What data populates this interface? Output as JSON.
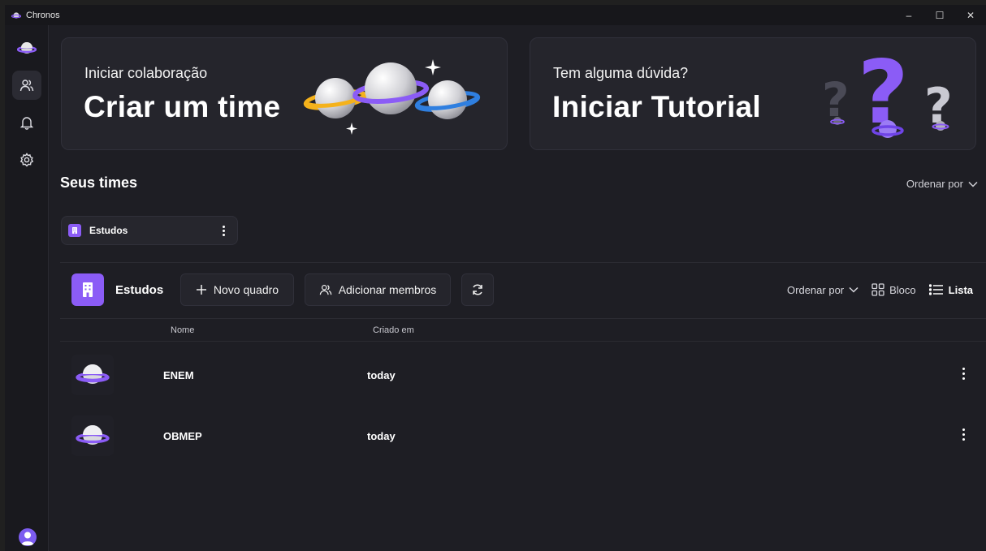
{
  "window": {
    "title": "Chronos",
    "controls": {
      "minimize": "–",
      "maximize": "☐",
      "close": "✕"
    }
  },
  "sidebar": {
    "items": [
      "logo",
      "teams",
      "notifications",
      "settings"
    ],
    "accent": "#7c5cf0"
  },
  "banners": {
    "create": {
      "small": "Iniciar colaboração",
      "big": "Criar um time"
    },
    "tutorial": {
      "small": "Tem alguma dúvida?",
      "big": "Iniciar Tutorial"
    }
  },
  "teams_section": {
    "title": "Seus times",
    "order_label": "Ordenar por"
  },
  "team_chip": {
    "label": "Estudos"
  },
  "toolbar": {
    "team_name": "Estudos",
    "new_board": "Novo quadro",
    "add_members": "Adicionar membros",
    "order_label": "Ordenar por",
    "view_block": "Bloco",
    "view_list": "Lista"
  },
  "table": {
    "columns": {
      "name": "Nome",
      "created": "Criado em"
    },
    "rows": [
      {
        "name": "ENEM",
        "created": "today"
      },
      {
        "name": "OBMEP",
        "created": "today"
      }
    ]
  },
  "colors": {
    "purple": "#8b5cf6",
    "yellow": "#f5b21b",
    "blue": "#2f7fe0",
    "background": "#1e1e24"
  }
}
